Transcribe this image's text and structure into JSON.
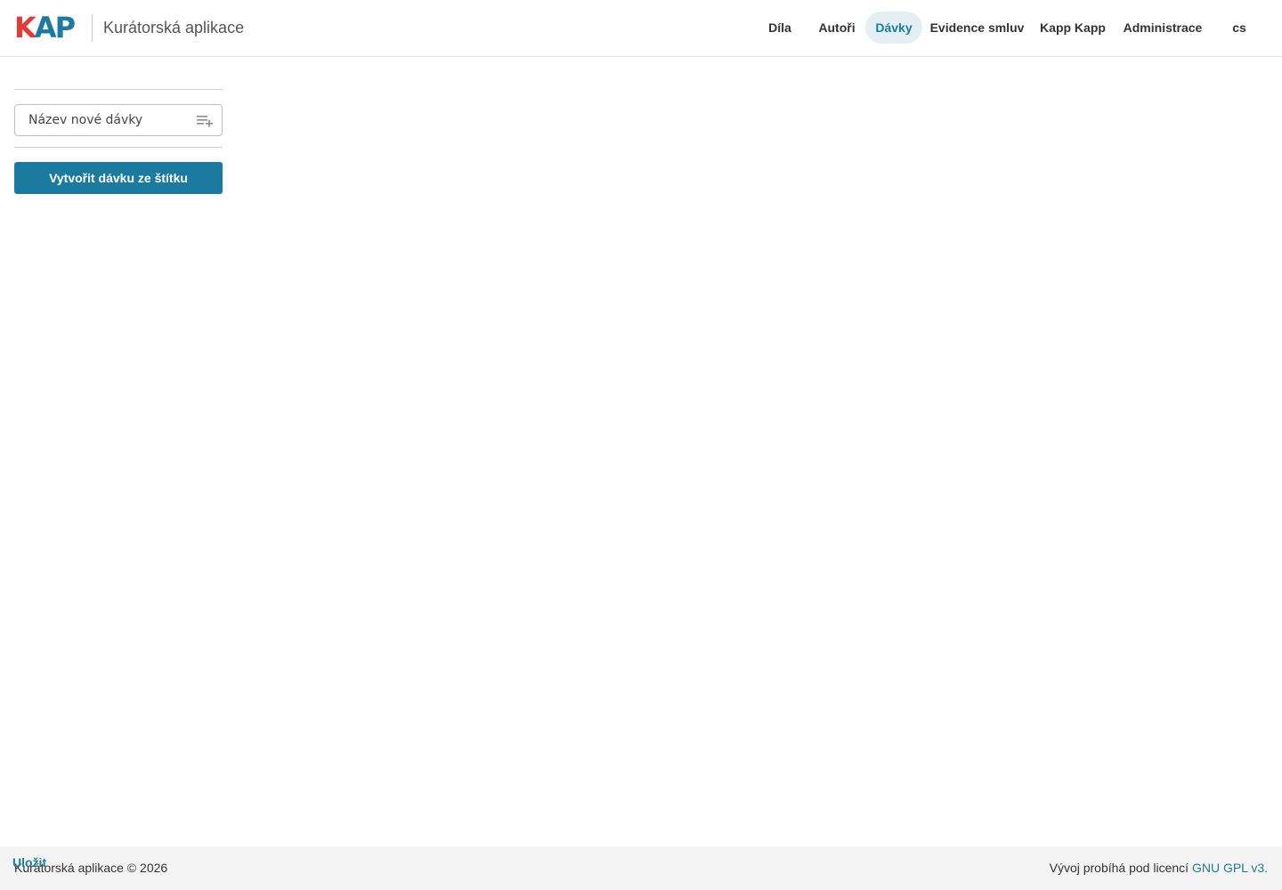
{
  "header": {
    "logo": {
      "k": "K",
      "ap": "AP"
    },
    "app_title": "Kurátorská aplikace",
    "nav": [
      {
        "label": "Díla",
        "active": false
      },
      {
        "label": "Autoři",
        "active": false
      },
      {
        "label": "Dávky",
        "active": true
      },
      {
        "label": "Evidence smluv",
        "active": false
      },
      {
        "label": "Kapp Kapp",
        "active": false
      },
      {
        "label": "Administrace",
        "active": false
      },
      {
        "label": "cs",
        "active": false
      }
    ]
  },
  "sidebar": {
    "new_batch_placeholder": "Název nové dávky",
    "new_batch_value": "",
    "add_icon": "playlist-add-icon",
    "create_from_tag_label": "Vytvořit dávku ze štítku"
  },
  "footer": {
    "save_label": "Uložit",
    "copyright": "Kurátorská aplikace © 2026",
    "license_text": "Vývoj probíhá pod licencí ",
    "license_link": "GNU GPL v3."
  },
  "colors": {
    "accent": "#1a7aa0",
    "logo_red": "#e53935",
    "active_tab_bg": "#e4eff4",
    "footer_bg": "#f4f4f4"
  }
}
